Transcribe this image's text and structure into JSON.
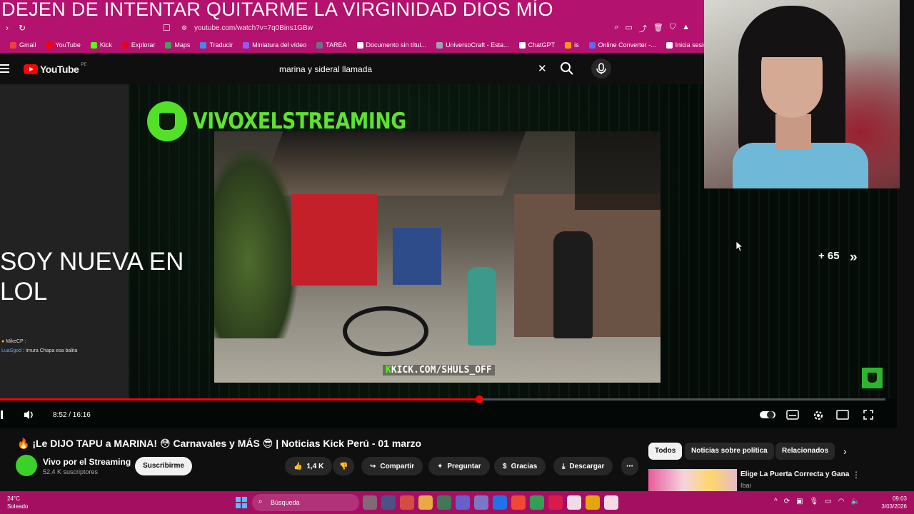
{
  "stream_overlay": {
    "banner": "DEJEN DE INTENTAR QUITARME LA VIRGINIDAD DIOS MÍO",
    "left_text": "SOY NUEVA EN LOL",
    "chat_lines": [
      {
        "user": "MikeCP",
        "text": ""
      },
      {
        "user": "LuaSgod",
        "text": "Imura Chapa esa balita"
      }
    ]
  },
  "browser": {
    "url": "youtube.com/watch?v=7q0Bins1GBw",
    "bookmarks": [
      {
        "label": "Gmail",
        "color": "#ea4335"
      },
      {
        "label": "YouTube",
        "color": "#ff0000"
      },
      {
        "label": "Kick",
        "color": "#53fc18"
      },
      {
        "label": "Explorar",
        "color": "#e60023"
      },
      {
        "label": "Maps",
        "color": "#34a853"
      },
      {
        "label": "Traducir",
        "color": "#4285f4"
      },
      {
        "label": "Miniatura del vídeo",
        "color": "#8b5cf6"
      },
      {
        "label": "TAREA",
        "color": "#6b7280"
      },
      {
        "label": "Documento sin títul...",
        "color": "#ffffff"
      },
      {
        "label": "UniversoCraft - Esta...",
        "color": "#9ca3af"
      },
      {
        "label": "ChatGPT",
        "color": "#ffffff"
      },
      {
        "label": "is",
        "color": "#f59e0b"
      },
      {
        "label": "Online Converter -...",
        "color": "#6366f1"
      },
      {
        "label": "Inicia sesión: Cuent...",
        "color": "#ffffff"
      }
    ]
  },
  "youtube": {
    "logo_text": "YouTube",
    "country_code": "PE",
    "search_query": "marina y sideral llamada"
  },
  "player": {
    "channel_brand": "VIVOXELSTREAMING",
    "kick_tag_prefix": "K",
    "kick_tag": "KICK.COM/SHULS_OFF",
    "skip_count": "+ 65",
    "time": "8:52 / 16:16",
    "progress": 0.541
  },
  "video": {
    "title": "🔥 ¡Le DIJO TAPU a MARINA! 😳 Carnavales y MÁS 😎 | Noticias Kick Perú - 01 marzo",
    "channel": "Vivo por el Streaming",
    "subscribers": "52,4 K suscriptores",
    "subscribe_label": "Suscribirme",
    "likes": "1,4 K",
    "share_label": "Compartir",
    "ask_label": "Preguntar",
    "thanks_label": "Gracias",
    "download_label": "Descargar"
  },
  "chips": [
    "Todos",
    "Noticias sobre política",
    "Relacionados"
  ],
  "recommendation": {
    "title": "Elige La Puerta Correcta y Gana",
    "channel": "Ibai"
  },
  "taskbar": {
    "temperature": "24°C",
    "weather": "Soleado",
    "search_placeholder": "Búsqueda",
    "time": "09:03",
    "date": "3/03/2026"
  }
}
